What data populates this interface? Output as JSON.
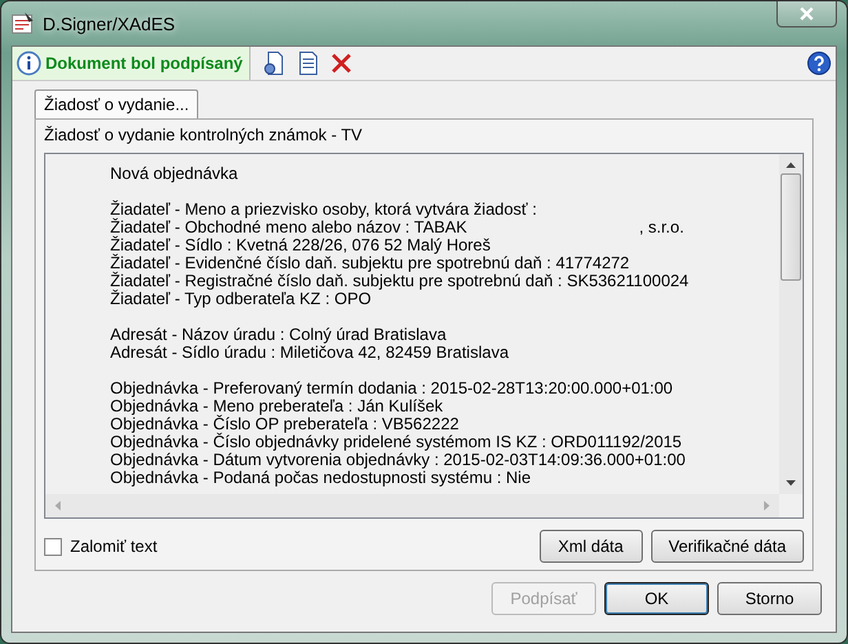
{
  "window": {
    "title": "D.Signer/XAdES"
  },
  "status": {
    "text": "Dokument bol podpísaný"
  },
  "tabs": [
    {
      "label": "Žiadosť o vydanie...",
      "selected": true
    }
  ],
  "panel": {
    "heading": "Žiadosť o vydanie kontrolných známok - TV",
    "sections": [
      {
        "lines": [
          {
            "text": "Nová objednávka"
          }
        ]
      },
      {
        "lines": [
          {
            "text": "Žiadateľ - Meno a priezvisko osoby, ktorá vytvára žiadosť :"
          },
          {
            "text": "Žiadateľ - Obchodné meno alebo názov : TABAK",
            "suffix": ", s.r.o."
          },
          {
            "text": "Žiadateľ - Sídlo : Kvetná 228/26, 076 52 Malý Horeš"
          },
          {
            "text": "Žiadateľ - Evidenčné číslo daň. subjektu pre spotrebnú daň : 41774272"
          },
          {
            "text": "Žiadateľ - Registračné číslo daň. subjektu pre spotrebnú daň : SK53621100024"
          },
          {
            "text": "Žiadateľ - Typ odberateľa KZ : OPO"
          }
        ]
      },
      {
        "lines": [
          {
            "text": "Adresát - Názov úradu : Colný úrad Bratislava"
          },
          {
            "text": "Adresát - Sídlo úradu : Miletičova 42, 82459 Bratislava"
          }
        ]
      },
      {
        "lines": [
          {
            "text": "Objednávka - Preferovaný termín dodania : 2015-02-28T13:20:00.000+01:00"
          },
          {
            "text": "Objednávka - Meno preberateľa : Ján Kulíšek"
          },
          {
            "text": "Objednávka - Číslo OP preberateľa : VB562222"
          },
          {
            "text": "Objednávka - Číslo objednávky pridelené systémom IS KZ : ORD011192/2015"
          },
          {
            "text": "Objednávka - Dátum vytvorenia objednávky : 2015-02-03T14:09:36.000+01:00"
          },
          {
            "text": "Objednávka - Podaná počas nedostupnosti systému : Nie"
          }
        ]
      }
    ],
    "wrap_checkbox": {
      "label": "Zalomiť text",
      "checked": false
    },
    "buttons": [
      {
        "label": "Xml dáta",
        "disabled": false
      },
      {
        "label": "Verifikačné dáta",
        "disabled": false
      }
    ]
  },
  "footer_buttons": [
    {
      "label": "Podpísať",
      "disabled": true,
      "default": false
    },
    {
      "label": "OK",
      "disabled": false,
      "default": true
    },
    {
      "label": "Storno",
      "disabled": false,
      "default": false
    }
  ]
}
